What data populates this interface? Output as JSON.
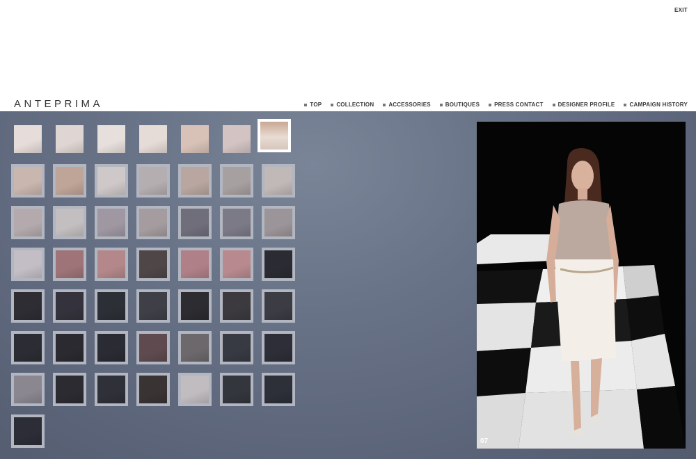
{
  "exit_label": "EXIT",
  "brand": "ANTEPRIMA",
  "nav": [
    {
      "label": "TOP",
      "id": "top"
    },
    {
      "label": "COLLECTION",
      "id": "collection"
    },
    {
      "label": "ACCESSORIES",
      "id": "accessories"
    },
    {
      "label": "BOUTIQUES",
      "id": "boutiques"
    },
    {
      "label": "PRESS CONTACT",
      "id": "press-contact"
    },
    {
      "label": "DESIGNER PROFILE",
      "id": "designer-profile"
    },
    {
      "label": "CAMPAIGN HISTORY",
      "id": "campaign-history"
    }
  ],
  "selected_look": 7,
  "photo_number": "07",
  "thumbnail_rows": [
    [
      "#e6dcda",
      "#dfd6d3",
      "#e7dfdc",
      "#e5dbd7",
      "#d8c2b8",
      "#d3c3c3"
    ],
    [
      "#c9b6ae",
      "#bfa598",
      "#cfc8c8",
      "#b4aeb1",
      "#b9a6a0",
      "#a7a0a0",
      "#c1b8b8"
    ],
    [
      "#b4aaad",
      "#c3bfc1",
      "#9f98a3",
      "#a49c9f",
      "#6f6e7a",
      "#7c7a86",
      "#9b9498"
    ],
    [
      "#c3bec5",
      "#9e7478",
      "#b4888a",
      "#4f4648",
      "#b08088",
      "#b88a8f",
      "#2b2c33"
    ],
    [
      "#2e2d34",
      "#34333d",
      "#2d2f37",
      "#3f3f47",
      "#2c2c31",
      "#3c3a3e",
      "#3b3c44"
    ],
    [
      "#2c2c34",
      "#2b2a31",
      "#2a2b33",
      "#5f4b4f",
      "#6c686c",
      "#383a43",
      "#2d2e37"
    ],
    [
      "#8a8790",
      "#2b2b31",
      "#303039",
      "#3a3334",
      "#c0bcbf",
      "#34363e",
      "#2d2f39"
    ],
    [
      "#2c2d37"
    ]
  ]
}
